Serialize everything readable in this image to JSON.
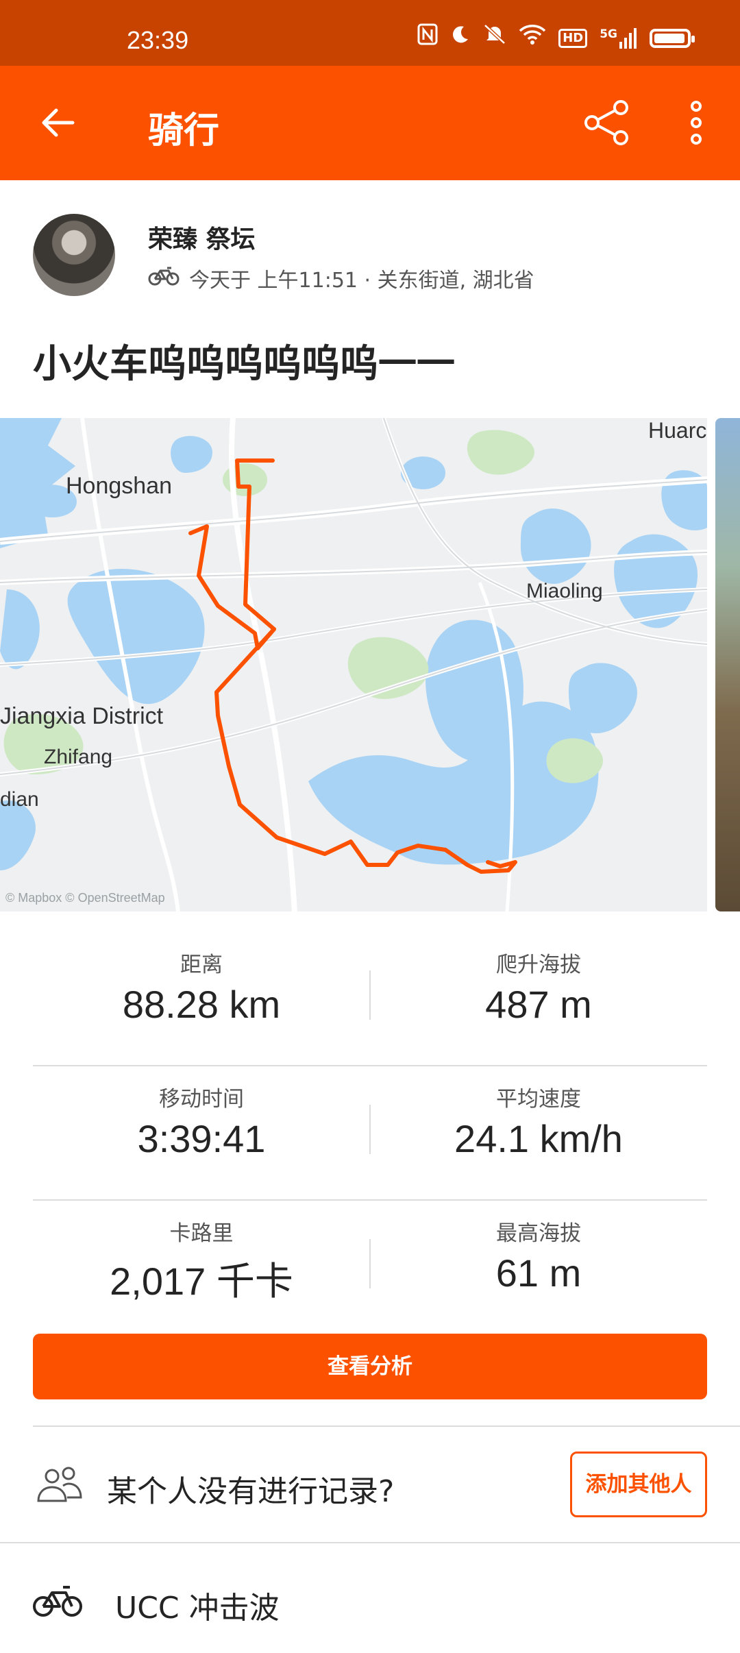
{
  "status_bar": {
    "time": "23:39",
    "icons": [
      "nfc-icon",
      "moon-icon",
      "mute-icon",
      "wifi-icon",
      "hd-icon",
      "signal-5g-icon",
      "battery-icon"
    ],
    "hd_label": "HD",
    "network_label": "5G",
    "battery_level": 0.95
  },
  "app_bar": {
    "title": "骑行",
    "back_icon": "arrow-left-icon",
    "share_icon": "share-icon",
    "more_icon": "more-vertical-icon"
  },
  "activity": {
    "athlete_name": "荣臻 祭坛",
    "meta_text": "今天于 上午11:51 · 关东街道, 湖北省",
    "title": "小火车呜呜呜呜呜呜一一"
  },
  "map": {
    "labels": {
      "hongshan": "Hongshan",
      "miaoling": "Miaoling",
      "jiangxia": "Jiangxia District",
      "zhifang": "Zhifang",
      "dian": "dian",
      "huarc": "Huarc",
      "attribution": "© Mapbox © OpenStreetMap"
    },
    "route_color": "#fc5200"
  },
  "stats": [
    {
      "left": {
        "label": "距离",
        "value": "88.28 km"
      },
      "right": {
        "label": "爬升海拔",
        "value": "487 m"
      }
    },
    {
      "left": {
        "label": "移动时间",
        "value": "3:39:41"
      },
      "right": {
        "label": "平均速度",
        "value": "24.1 km/h"
      }
    },
    {
      "left": {
        "label": "卡路里",
        "value": "2,017 千卡"
      },
      "right": {
        "label": "最高海拔",
        "value": "61 m"
      }
    }
  ],
  "actions": {
    "analyze_label": "查看分析",
    "missing_text": "某个人没有进行记录?",
    "add_others_label": "添加其他人"
  },
  "gear": {
    "name": "UCC 冲击波"
  },
  "colors": {
    "brand": "#fc5200",
    "status_bar": "#c94300"
  }
}
